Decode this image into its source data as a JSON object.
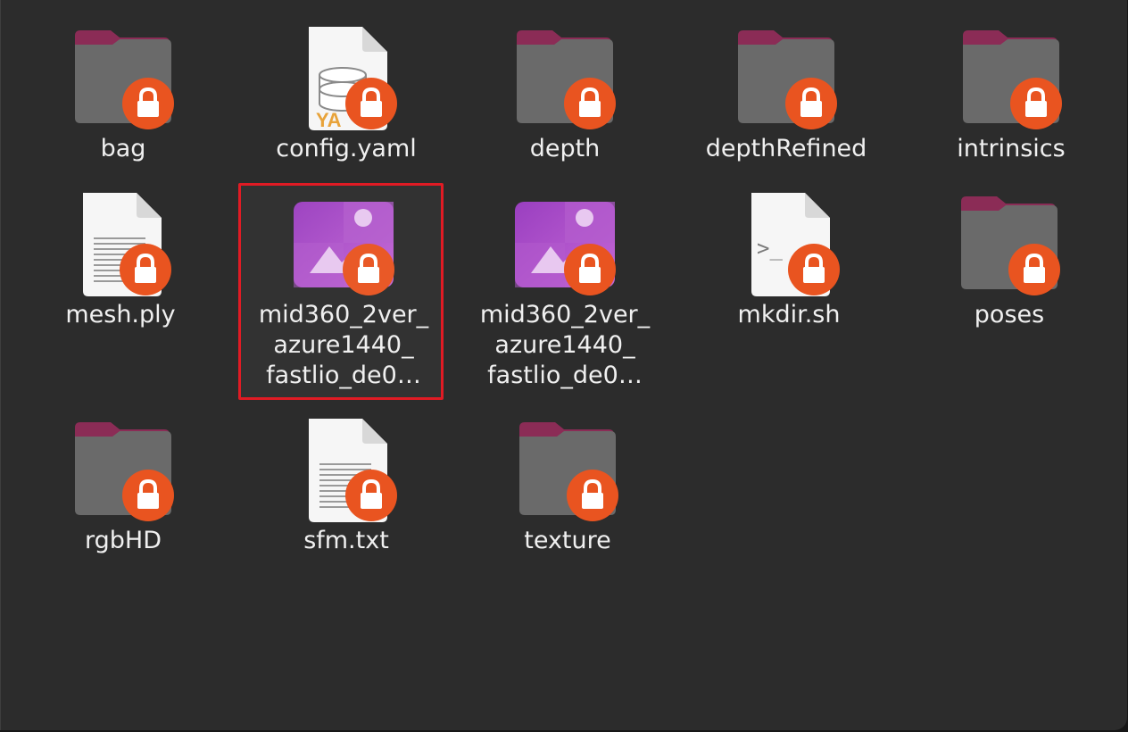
{
  "files": [
    {
      "name": "bag",
      "type": "folder"
    },
    {
      "name": "config.yaml",
      "type": "yaml"
    },
    {
      "name": "depth",
      "type": "folder"
    },
    {
      "name": "depthRefined",
      "type": "folder"
    },
    {
      "name": "intrinsics",
      "type": "folder"
    },
    {
      "name": "mesh.ply",
      "type": "text"
    },
    {
      "name": "mid360_2ver_\nazure1440_\nfastlio_de0…",
      "type": "image"
    },
    {
      "name": "mid360_2ver_\nazure1440_\nfastlio_de0…",
      "type": "image"
    },
    {
      "name": "mkdir.sh",
      "type": "script"
    },
    {
      "name": "poses",
      "type": "folder"
    },
    {
      "name": "rgbHD",
      "type": "folder"
    },
    {
      "name": "sfm.txt",
      "type": "text"
    },
    {
      "name": "texture",
      "type": "folder"
    }
  ],
  "icons": {
    "folder": "folder-icon",
    "yaml": "yaml-file-icon",
    "text": "text-file-icon",
    "image": "image-file-icon",
    "script": "script-file-icon",
    "lock": "lock-icon",
    "yaml_badge_text": "YA"
  },
  "colors": {
    "background": "#2c2c2c",
    "folder_body": "#6a6a6a",
    "folder_tab": "#8b2c56",
    "lock_badge": "#e95420",
    "image_icon": "#a64fc8",
    "selection_border": "#e01b24"
  },
  "selected_index": 6
}
